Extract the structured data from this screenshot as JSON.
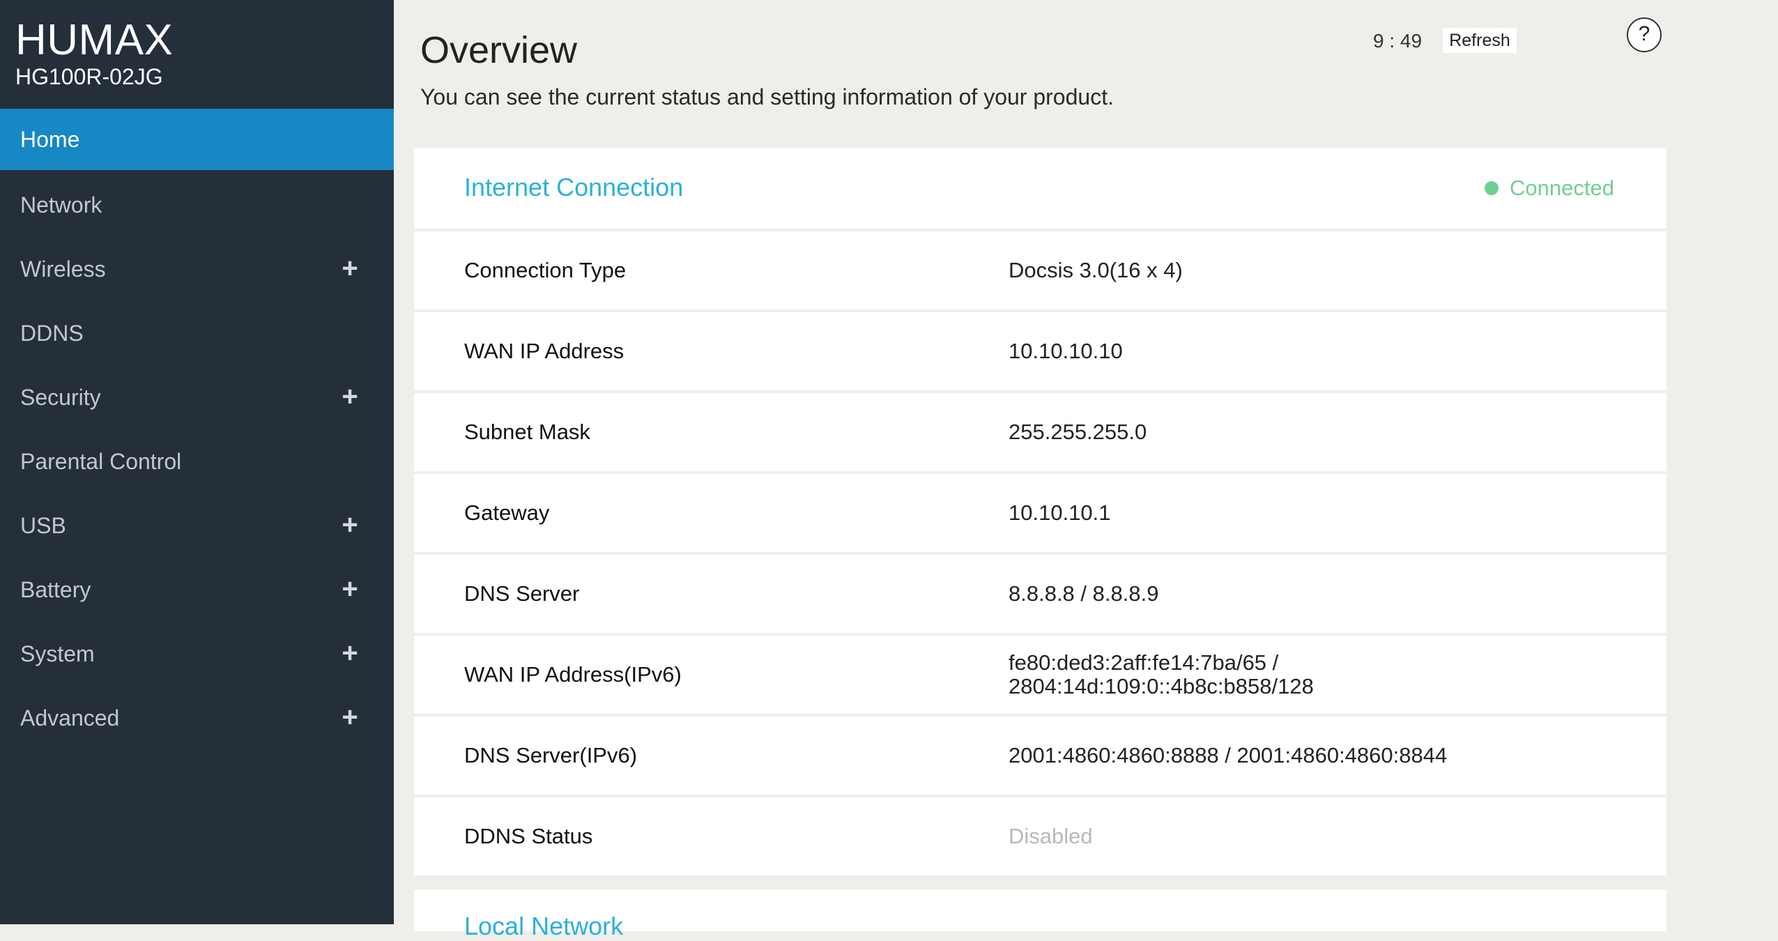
{
  "brand": {
    "logo": "HUMAX",
    "model": "HG100R-02JG"
  },
  "nav": {
    "items": [
      {
        "label": "Home",
        "active": true,
        "expandable": false
      },
      {
        "label": "Network",
        "active": false,
        "expandable": false
      },
      {
        "label": "Wireless",
        "active": false,
        "expandable": true
      },
      {
        "label": "DDNS",
        "active": false,
        "expandable": false
      },
      {
        "label": "Security",
        "active": false,
        "expandable": true
      },
      {
        "label": "Parental Control",
        "active": false,
        "expandable": false
      },
      {
        "label": "USB",
        "active": false,
        "expandable": true
      },
      {
        "label": "Battery",
        "active": false,
        "expandable": true
      },
      {
        "label": "System",
        "active": false,
        "expandable": true
      },
      {
        "label": "Advanced",
        "active": false,
        "expandable": true
      }
    ],
    "expand_glyph": "+"
  },
  "header": {
    "title": "Overview",
    "description": "You can see the current status and setting information of your product.",
    "clock": "9 : 49",
    "refresh_label": "Refresh",
    "help_label": "?"
  },
  "internet": {
    "title": "Internet Connection",
    "status": "Connected",
    "status_color": "#6fcf93",
    "rows": [
      {
        "label": "Connection Type",
        "value": "Docsis 3.0(16 x 4)",
        "muted": false
      },
      {
        "label": "WAN IP Address",
        "value": "10.10.10.10",
        "muted": false
      },
      {
        "label": "Subnet Mask",
        "value": "255.255.255.0",
        "muted": false
      },
      {
        "label": "Gateway",
        "value": "10.10.10.1",
        "muted": false
      },
      {
        "label": "DNS Server",
        "value": "8.8.8.8 / 8.8.8.9",
        "muted": false
      },
      {
        "label": "WAN IP Address(IPv6)",
        "value": "fe80:ded3:2aff:fe14:7ba/65 /\n2804:14d:109:0::4b8c:b858/128",
        "muted": false
      },
      {
        "label": "DNS Server(IPv6)",
        "value": "2001:4860:4860:8888 / 2001:4860:4860:8844",
        "muted": false
      },
      {
        "label": "DDNS Status",
        "value": "Disabled",
        "muted": true
      }
    ]
  },
  "local": {
    "title": "Local Network"
  },
  "colors": {
    "accent": "#1787c6",
    "sidebar": "#252f3a",
    "section_title": "#2ab0dc"
  }
}
